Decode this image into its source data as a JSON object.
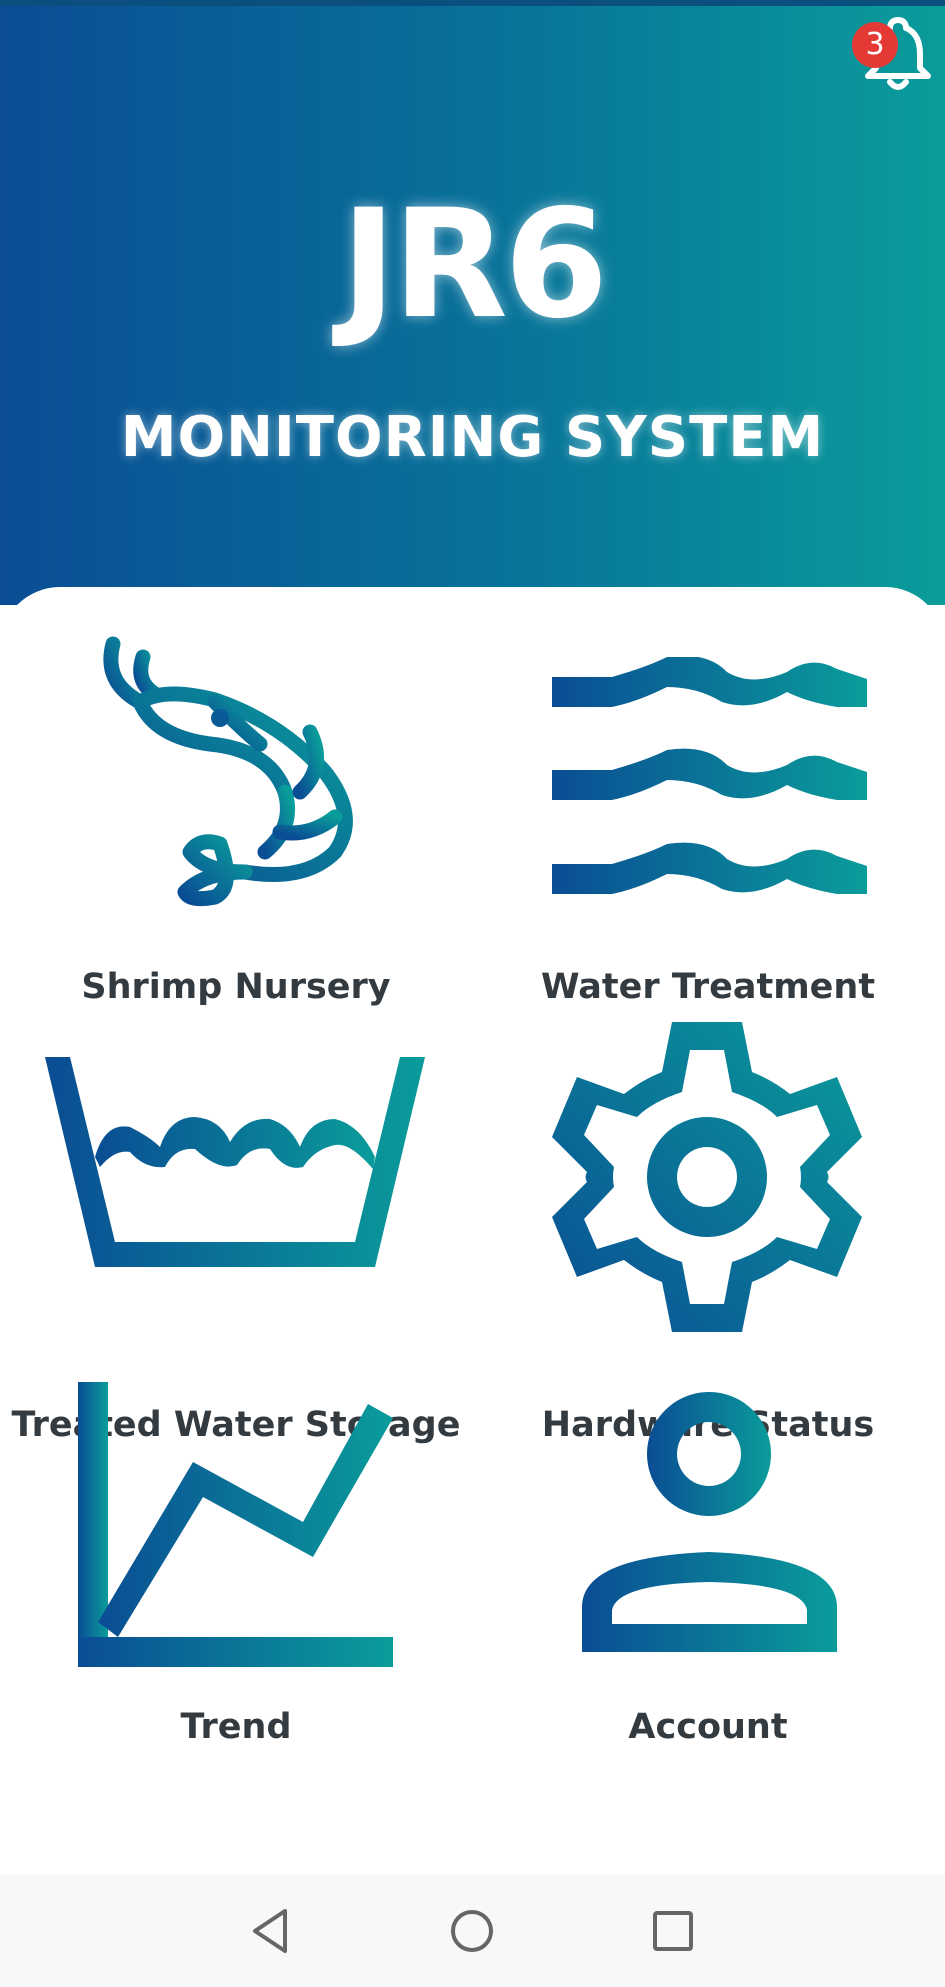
{
  "header": {
    "title": "JR6",
    "subtitle": "MONITORING SYSTEM",
    "notification_count": "3"
  },
  "menu": {
    "items": [
      {
        "label": "Shrimp Nursery",
        "icon": "shrimp-icon"
      },
      {
        "label": "Water Treatment",
        "icon": "water-waves-icon"
      },
      {
        "label": "Treated Water Storage",
        "icon": "water-basin-icon"
      },
      {
        "label": "Hardware Status",
        "icon": "gear-icon"
      },
      {
        "label": "Trend",
        "icon": "trend-chart-icon"
      },
      {
        "label": "Account",
        "icon": "account-icon"
      }
    ]
  },
  "navigation_bar": {
    "buttons": [
      "back-icon",
      "home-icon",
      "recents-icon"
    ]
  },
  "colors": {
    "gradient_start": "#0a4d94",
    "gradient_end": "#0a9c9a",
    "badge": "#e53935",
    "label_text": "#333b40"
  }
}
